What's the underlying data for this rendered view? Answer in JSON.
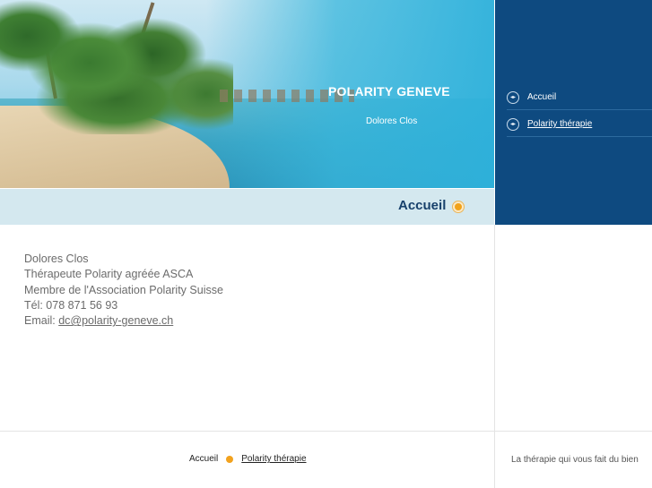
{
  "header": {
    "site_title": "POLARITY GENEVE",
    "site_subtitle": "Dolores Clos"
  },
  "nav": {
    "items": [
      {
        "label": "Accueil",
        "bullet_icon": "arrows-circle-icon"
      },
      {
        "label": "Polarity thérapie",
        "bullet_icon": "arrows-circle-icon"
      }
    ]
  },
  "page": {
    "title": "Accueil",
    "title_icon": "orange-dot-icon"
  },
  "content": {
    "lines": [
      "Dolores Clos",
      "Thérapeute Polarity agréée ASCA",
      "Membre de l'Association Polarity Suisse",
      "Tél: 078 871 56 93"
    ],
    "email_label": "Email: ",
    "email_link": "dc@polarity-geneve.ch"
  },
  "footer": {
    "nav": [
      "Accueil",
      "Polarity thérapie"
    ],
    "tagline": "La thérapie qui vous fait du bien"
  },
  "colors": {
    "nav_panel": "#0e4a80",
    "title_bar": "#d4e8ef",
    "title_text": "#17406b",
    "accent_orange": "#f2a21e"
  }
}
